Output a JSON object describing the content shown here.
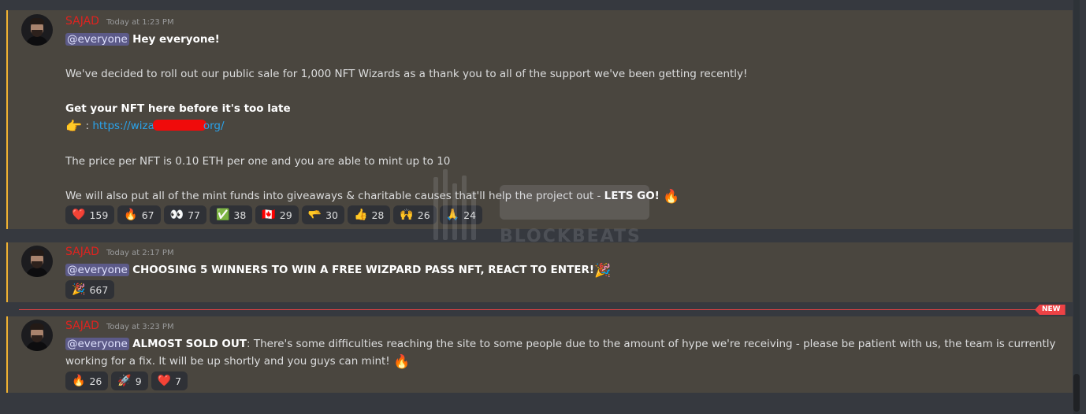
{
  "messages": [
    {
      "author": "SAJAD",
      "timestamp": "Today at 1:23 PM",
      "mention": "@everyone",
      "heading": "Hey everyone!",
      "para1": "We've decided to roll out our public sale for 1,000 NFT Wizards as a thank you to all of the support we've been getting recently!",
      "cta_bold": "Get your NFT here before it's too late",
      "link_prefix": "https://wiza",
      "link_suffix": "org/",
      "link_separator": " : ",
      "para3": "The price per NFT is 0.10 ETH per one and you are able to mint up to 10",
      "para4": "We will also put all of the mint funds into giveaways & charitable causes that'll help the project out - ",
      "para4_bold": "LETS GO!",
      "reactions": [
        {
          "emoji": "❤️",
          "count": "159"
        },
        {
          "emoji": "🔥",
          "count": "67"
        },
        {
          "emoji": "👀",
          "count": "77"
        },
        {
          "emoji": "✅",
          "count": "38"
        },
        {
          "emoji": "🇨🇦",
          "count": "29"
        },
        {
          "emoji": "🫳",
          "count": "30"
        },
        {
          "emoji": "👍",
          "count": "28"
        },
        {
          "emoji": "🙌",
          "count": "26"
        },
        {
          "emoji": "🙏",
          "count": "24"
        }
      ]
    },
    {
      "author": "SAJAD",
      "timestamp": "Today at 2:17 PM",
      "mention": "@everyone",
      "text_bold": "CHOOSING 5 WINNERS TO WIN A FREE WIZPARD PASS NFT, REACT TO ENTER!",
      "reactions": [
        {
          "emoji": "🎉",
          "count": "667"
        }
      ]
    },
    {
      "author": "SAJAD",
      "timestamp": "Today at 3:23 PM",
      "mention": "@everyone",
      "text_bold": "ALMOST SOLD OUT",
      "text_line1": ": There's some difficulties reaching the site to some people due to the amount of hype we're receiving - please be patient with us, the team is currently",
      "text_line2": "working for a fix. It will be up shortly and you guys can mint! ",
      "reactions": [
        {
          "emoji": "🔥",
          "count": "26"
        },
        {
          "emoji": "🚀",
          "count": "9"
        },
        {
          "emoji": "❤️",
          "count": "7"
        }
      ]
    }
  ],
  "new_divider_label": "NEW",
  "watermark_text": "BLOCKBEATS",
  "icons": {
    "pointing_hand": "👉",
    "fire": "🔥",
    "party": "🎉"
  },
  "colors": {
    "author": "#e0231f",
    "mention_bg": "#5c5a88",
    "link": "#2aa2ea",
    "highlight_border": "#f0b232",
    "new_divider": "#ed4245"
  }
}
